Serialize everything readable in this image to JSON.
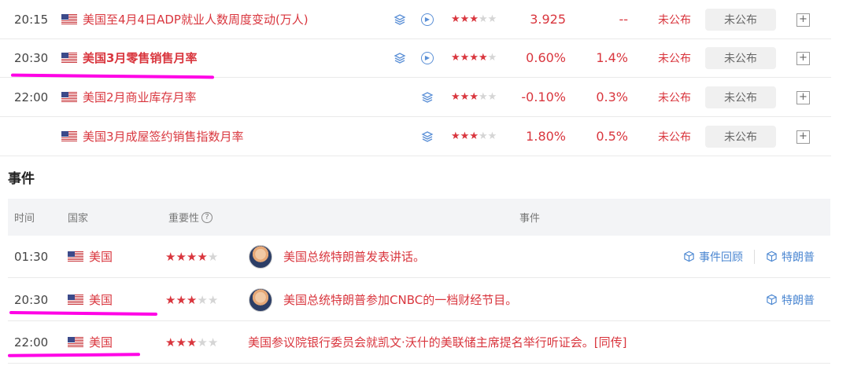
{
  "indicators": [
    {
      "time": "20:15",
      "title": "美国至4月4日ADP就业人数周度变动(万人)",
      "stars": 3,
      "has_play": true,
      "previous": "3.925",
      "forecast": "--",
      "actual": "未公布",
      "button": "未公布",
      "bold": false
    },
    {
      "time": "20:30",
      "title": "美国3月零售销售月率",
      "stars": 4,
      "has_play": true,
      "previous": "0.60%",
      "forecast": "1.4%",
      "actual": "未公布",
      "button": "未公布",
      "bold": true
    },
    {
      "time": "22:00",
      "title": "美国2月商业库存月率",
      "stars": 3,
      "has_play": false,
      "previous": "-0.10%",
      "forecast": "0.3%",
      "actual": "未公布",
      "button": "未公布",
      "bold": false
    },
    {
      "time": "",
      "title": "美国3月成屋签约销售指数月率",
      "stars": 3,
      "has_play": false,
      "previous": "1.80%",
      "forecast": "0.5%",
      "actual": "未公布",
      "button": "未公布",
      "bold": false
    }
  ],
  "events_section": {
    "title": "事件",
    "headers": {
      "time": "时间",
      "country": "国家",
      "importance": "重要性",
      "event": "事件"
    },
    "rows": [
      {
        "time": "01:30",
        "country": "美国",
        "stars": 4,
        "has_avatar": true,
        "event": "美国总统特朗普发表讲话。",
        "links": [
          "事件回顾",
          "特朗普"
        ]
      },
      {
        "time": "20:30",
        "country": "美国",
        "stars": 3,
        "has_avatar": true,
        "event": "美国总统特朗普参加CNBC的一档财经节目。",
        "links": [
          "特朗普"
        ]
      },
      {
        "time": "22:00",
        "country": "美国",
        "stars": 3,
        "has_avatar": false,
        "event": "美国参议院银行委员会就凯文·沃什的美联储主席提名举行听证会。[同传]",
        "links": []
      }
    ]
  },
  "colors": {
    "accent_red": "#d9363e",
    "link_blue": "#4a86d1",
    "highlight_mark": "#ff00e6"
  },
  "icons": {
    "flag": "us-flag-icon",
    "stack": "layers-icon",
    "play": "play-circle-icon",
    "plus": "plus-box-icon",
    "cube": "cube-icon",
    "help": "question-circle-icon"
  }
}
